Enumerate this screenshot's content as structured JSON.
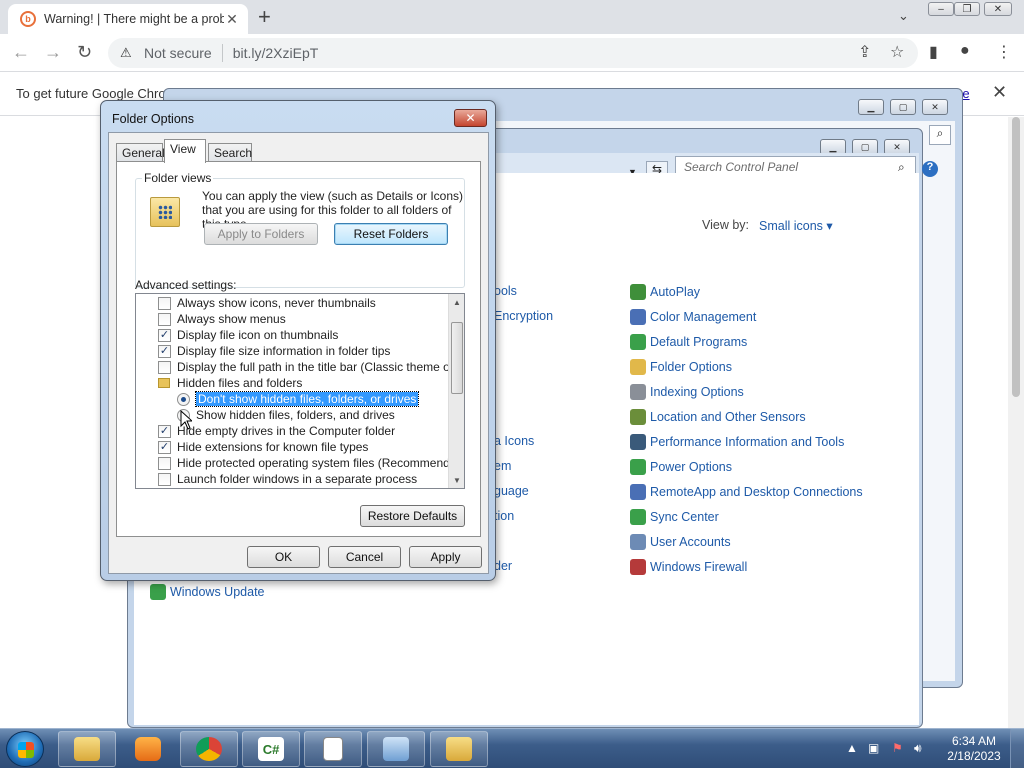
{
  "browser": {
    "tab_title": "Warning! | There might be a prob",
    "security": "Not secure",
    "url": "bit.ly/2XziEpT",
    "infobar_message": "To get future Google Chro",
    "infobar_link": "re"
  },
  "control_panel": {
    "search_placeholder": "Search Control Panel",
    "view_by_label": "View by:",
    "view_by_value": "Small icons",
    "left_partial": [
      {
        "label": "ools"
      },
      {
        "label": "Encryption"
      },
      {
        "label": "a Icons"
      },
      {
        "label": "em"
      },
      {
        "label": "guage"
      },
      {
        "label": "tion"
      },
      {
        "label": "der"
      }
    ],
    "bottom_item": "Windows Update",
    "items": [
      {
        "label": "AutoPlay",
        "color": "#3f8f3a"
      },
      {
        "label": "Color Management",
        "color": "#4a6fb5"
      },
      {
        "label": "Default Programs",
        "color": "#3aa04a"
      },
      {
        "label": "Folder Options",
        "color": "#e1b84a"
      },
      {
        "label": "Indexing Options",
        "color": "#8a8f98"
      },
      {
        "label": "Location and Other Sensors",
        "color": "#6b8e3a"
      },
      {
        "label": "Performance Information and Tools",
        "color": "#3a5a7a"
      },
      {
        "label": "Power Options",
        "color": "#3aa04a"
      },
      {
        "label": "RemoteApp and Desktop Connections",
        "color": "#4a6fb5"
      },
      {
        "label": "Sync Center",
        "color": "#3aa04a"
      },
      {
        "label": "User Accounts",
        "color": "#6d8bb5"
      },
      {
        "label": "Windows Firewall",
        "color": "#b53a3a"
      }
    ]
  },
  "dialog": {
    "title": "Folder Options",
    "tabs": [
      "General",
      "View",
      "Search"
    ],
    "folder_views_label": "Folder views",
    "folder_views_text": "You can apply the view (such as Details or Icons) that you are using for this folder to all folders of this type.",
    "apply_to_folders": "Apply to Folders",
    "reset_folders": "Reset Folders",
    "advanced_label": "Advanced settings:",
    "settings": [
      {
        "kind": "checkbox",
        "checked": false,
        "label": "Always show icons, never thumbnails"
      },
      {
        "kind": "checkbox",
        "checked": false,
        "label": "Always show menus"
      },
      {
        "kind": "checkbox",
        "checked": true,
        "label": "Display file icon on thumbnails"
      },
      {
        "kind": "checkbox",
        "checked": true,
        "label": "Display file size information in folder tips"
      },
      {
        "kind": "checkbox",
        "checked": false,
        "label": "Display the full path in the title bar (Classic theme only)"
      },
      {
        "kind": "folder",
        "label": "Hidden files and folders"
      },
      {
        "kind": "radio",
        "checked": true,
        "selected": true,
        "label": "Don't show hidden files, folders, or drives"
      },
      {
        "kind": "radio",
        "checked": false,
        "label": "Show hidden files, folders, and drives"
      },
      {
        "kind": "checkbox",
        "checked": true,
        "label": "Hide empty drives in the Computer folder"
      },
      {
        "kind": "checkbox",
        "checked": true,
        "label": "Hide extensions for known file types"
      },
      {
        "kind": "checkbox",
        "checked": false,
        "label": "Hide protected operating system files (Recommended)"
      },
      {
        "kind": "checkbox",
        "checked": false,
        "label": "Launch folder windows in a separate process"
      }
    ],
    "restore_defaults": "Restore Defaults",
    "ok": "OK",
    "cancel": "Cancel",
    "apply": "Apply"
  },
  "taskbar": {
    "time": "6:34 AM",
    "date": "2/18/2023"
  }
}
